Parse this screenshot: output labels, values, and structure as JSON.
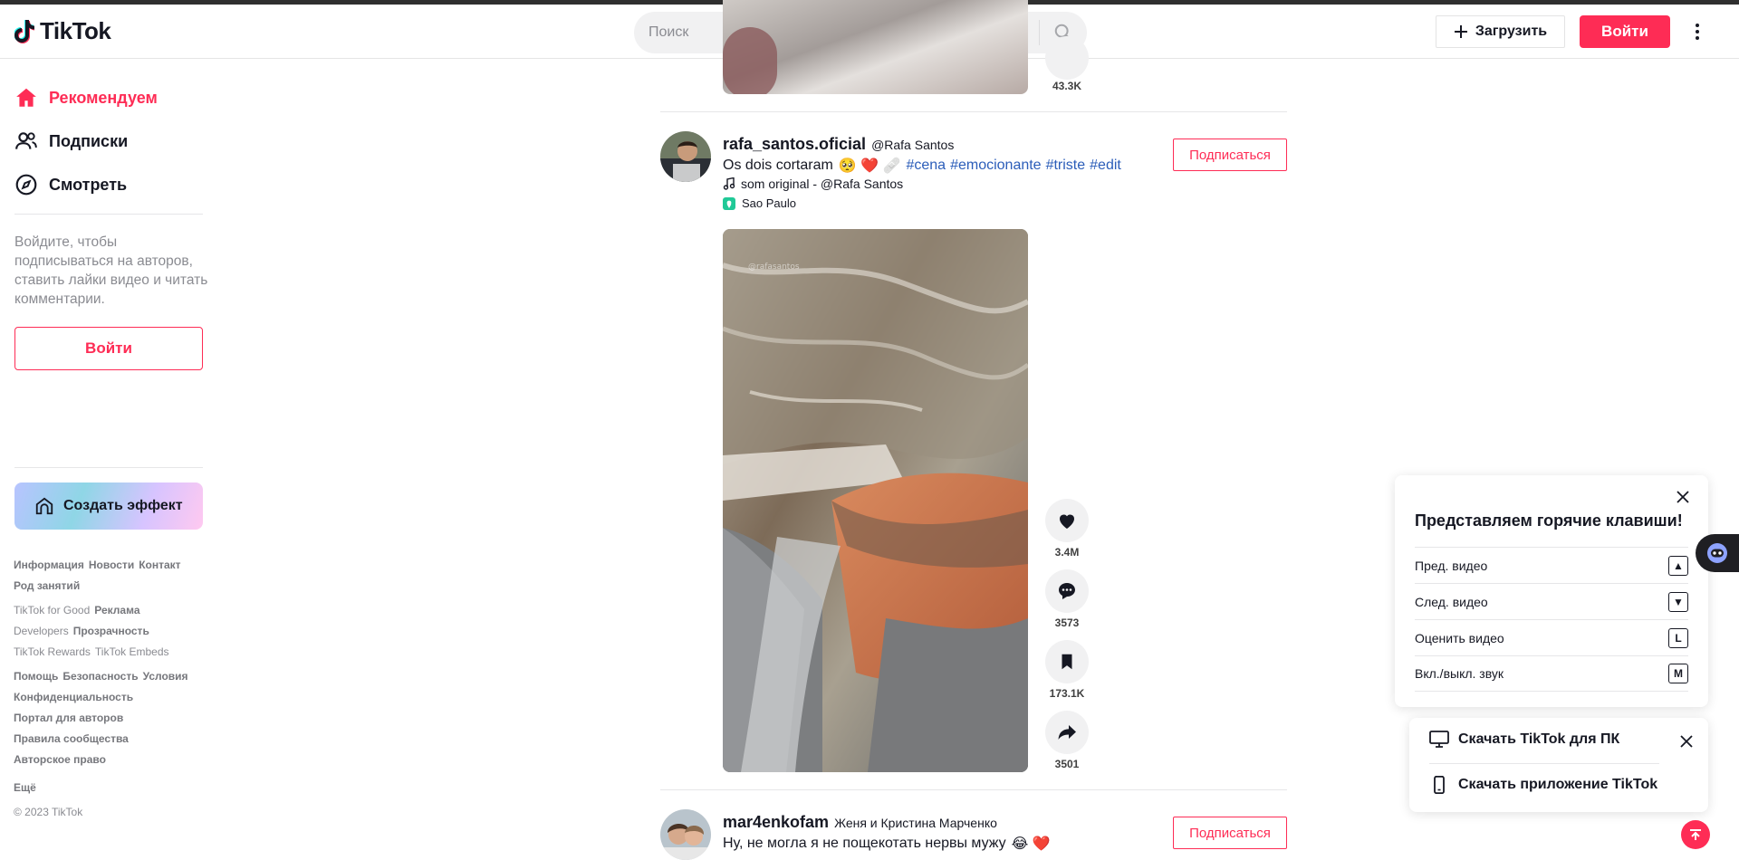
{
  "app": {
    "brand": "TikTok"
  },
  "header": {
    "search_placeholder": "Поиск",
    "upload_label": "Загрузить",
    "login_label": "Войти"
  },
  "sidebar": {
    "nav": [
      {
        "label": "Рекомендуем",
        "icon": "home-icon",
        "active": true
      },
      {
        "label": "Подписки",
        "icon": "following-icon",
        "active": false
      },
      {
        "label": "Смотреть",
        "icon": "compass-icon",
        "active": false
      }
    ],
    "hint": "Войдите, чтобы подписываться на авторов, ставить лайки видео и читать комментарии.",
    "login_label": "Войти",
    "effect_label": "Создать эффект",
    "footer": {
      "row1": [
        "Информация",
        "Новости",
        "Контакт"
      ],
      "row2": [
        "Род занятий"
      ],
      "row3": [
        "TikTok for Good",
        "Реклама"
      ],
      "row4": [
        "Developers",
        "Прозрачность"
      ],
      "row5": [
        "TikTok Rewards",
        "TikTok Embeds"
      ],
      "row6": [
        "Помощь",
        "Безопасность",
        "Условия"
      ],
      "row7": [
        "Конфиденциальность"
      ],
      "row8": [
        "Портал для авторов"
      ],
      "row9": [
        "Правила сообщества"
      ],
      "row10": [
        "Авторское право"
      ],
      "more": "Ещё",
      "copyright": "© 2023 TikTok"
    }
  },
  "feed": {
    "prev_count": "43.3K",
    "posts": [
      {
        "author": "rafa_santos.oficial",
        "nickname": "@Rafa Santos",
        "caption": "Os dois cortaram",
        "emojis": "🥺 ❤️ 🩹",
        "tags": [
          "#cena",
          "#emocionante",
          "#triste",
          "#edit"
        ],
        "music": "som original - @Rafa Santos",
        "location": "Sao Paulo",
        "follow_label": "Подписаться",
        "likes": "3.4M",
        "comments": "3573",
        "saves": "173.1K",
        "shares": "3501"
      },
      {
        "author": "mar4enkofam",
        "nickname": "Женя и Кристина Марченко",
        "caption": "Ну, не могла я не пощекотать нервы мужу",
        "emojis": "😂 ❤️",
        "follow_label": "Подписаться"
      }
    ]
  },
  "hotkeys": {
    "title": "Представляем горячие клавиши!",
    "rows": [
      {
        "label": "Пред. видео",
        "key": "▲"
      },
      {
        "label": "След. видео",
        "key": "▼"
      },
      {
        "label": "Оценить видео",
        "key": "L"
      },
      {
        "label": "Вкл./выкл. звук",
        "key": "M"
      }
    ]
  },
  "download": {
    "desktop_label": "Скачать TikTok для ПК",
    "app_label": "Скачать приложение TikTok"
  },
  "colors": {
    "accent": "#fe2c55",
    "hashtag": "#2b5db9",
    "text": "#161823",
    "muted": "#8a8b91"
  }
}
